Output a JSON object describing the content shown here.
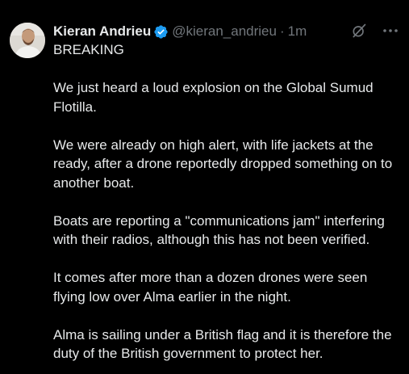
{
  "tweet": {
    "author": {
      "name": "Kieran Andrieu",
      "handle": "@kieran_andrieu",
      "separator": "·",
      "time": "1m",
      "verified_color": "#1d9bf0"
    },
    "paragraphs": [
      "BREAKING",
      "We just heard a loud explosion on the Global Sumud Flotilla.",
      "We were already on high alert, with life jackets at the ready, after a drone reportedly dropped something on to another boat.",
      "Boats are reporting a \"communications jam\" interfering with their radios, although this has not been verified.",
      "It comes after more than a dozen drones were seen flying low over Alma earlier in the night.",
      "Alma is sailing under a British flag and it is therefore the duty of the British government to protect her."
    ],
    "icons": {
      "grok": "grok-icon",
      "more": "more-icon",
      "verified": "verified-badge-icon"
    }
  }
}
